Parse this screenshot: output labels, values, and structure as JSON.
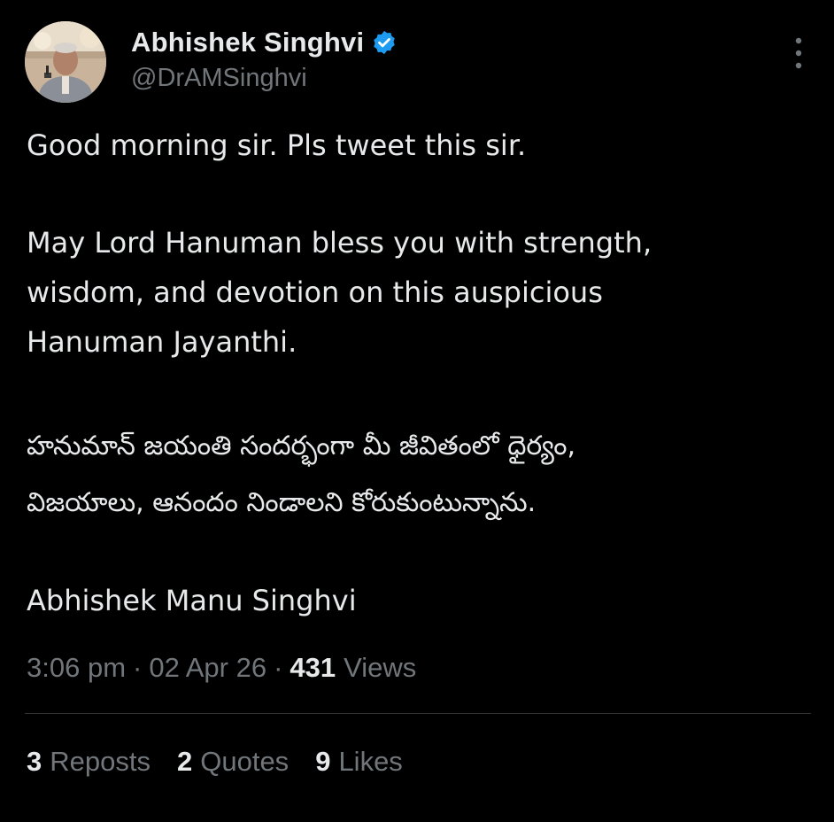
{
  "author": {
    "display_name": "Abhishek Singhvi",
    "handle": "@DrAMSinghvi",
    "verified": true,
    "verified_color": "#1d9bf0"
  },
  "icons": {
    "verified": "verified-badge-icon",
    "more": "more-vertical-icon"
  },
  "tweet": {
    "line1": "Good morning sir. Pls tweet this sir.",
    "line2": "May Lord Hanuman bless you with strength,",
    "line3": "wisdom, and devotion on this auspicious",
    "line4": "Hanuman Jayanthi.",
    "telugu1": "హనుమాన్ జయంతి సందర్భంగా మీ జీవితంలో ధైర్యం,",
    "telugu2": "విజయాలు, ఆనందం నిండాలని కోరుకుంటున్నాను.",
    "signature": "Abhishek Manu Singhvi"
  },
  "meta": {
    "time": "3:06 pm",
    "date": "02 Apr 26",
    "sep": "·",
    "views_count": "431",
    "views_label": "Views"
  },
  "stats": {
    "reposts_count": "3",
    "reposts_label": "Reposts",
    "quotes_count": "2",
    "quotes_label": "Quotes",
    "likes_count": "9",
    "likes_label": "Likes"
  },
  "colors": {
    "background": "#000000",
    "text": "#e7e9ea",
    "muted": "#71767b",
    "divider": "#2f3336"
  }
}
